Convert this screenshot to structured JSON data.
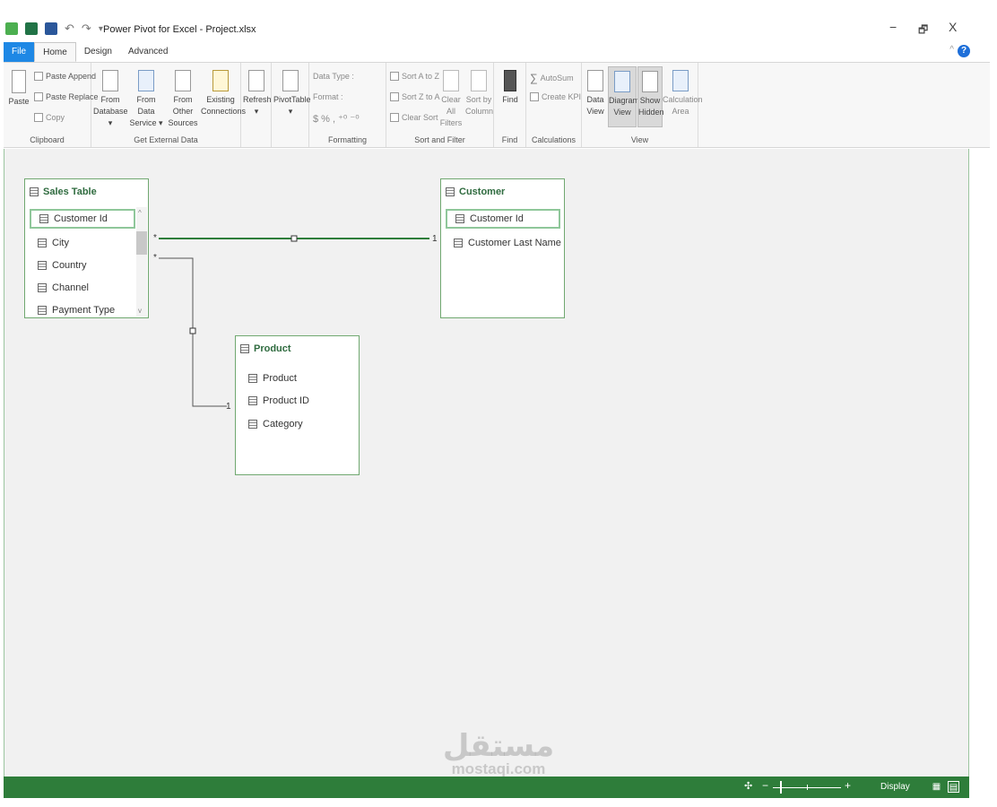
{
  "window": {
    "title": "Power Pivot for Excel - Project.xlsx",
    "minimize": "−",
    "restore": "🗗",
    "close": "X"
  },
  "tabs": [
    "File",
    "Home",
    "Design",
    "Advanced"
  ],
  "ribbon": {
    "clipboard": {
      "name": "Clipboard",
      "paste": "Paste",
      "paste_append": "Paste Append",
      "paste_replace": "Paste Replace",
      "copy": "Copy"
    },
    "external": {
      "name": "Get External Data",
      "from_database": [
        "From",
        "Database ▾"
      ],
      "from_data_service": [
        "From Data",
        "Service ▾"
      ],
      "from_other_sources": [
        "From Other",
        "Sources"
      ],
      "existing_connections": [
        "Existing",
        "Connections"
      ]
    },
    "refresh": {
      "label": "Refresh",
      "arrow": "▾"
    },
    "pivottable": {
      "label": "PivotTable",
      "arrow": "▾"
    },
    "formatting": {
      "name": "Formatting",
      "data_type": "Data Type :",
      "format": "Format :",
      "symbols": "$  %  ,  ⁺⁰  ⁻⁰"
    },
    "sort_filter": {
      "name": "Sort and Filter",
      "sort_az": "Sort A to Z",
      "sort_za": "Sort Z to A",
      "clear_sort": "Clear Sort",
      "clear_filters": [
        "Clear All",
        "Filters"
      ],
      "sort_by_column": [
        "Sort by",
        "Column"
      ]
    },
    "find": {
      "name": "Find",
      "label": "Find"
    },
    "calculations": {
      "name": "Calculations",
      "autosum": "AutoSum",
      "create_kpi": "Create KPI"
    },
    "view": {
      "name": "View",
      "data_view": [
        "Data",
        "View"
      ],
      "diagram_view": [
        "Diagram",
        "View"
      ],
      "show_hidden": [
        "Show",
        "Hidden"
      ],
      "calculation_area": [
        "Calculation",
        "Area"
      ]
    }
  },
  "diagram": {
    "tables": [
      {
        "name": "Sales Table",
        "fields": [
          "Customer Id",
          "City",
          "Country",
          "Channel",
          "Payment Type"
        ]
      },
      {
        "name": "Customer",
        "fields": [
          "Customer Id",
          "Customer Last Name"
        ]
      },
      {
        "name": "Product",
        "fields": [
          "Product",
          "Product ID",
          "Category"
        ]
      }
    ],
    "relationships": [
      {
        "from": "Sales Table",
        "to": "Customer",
        "from_card": "*",
        "to_card": "1"
      },
      {
        "from": "Sales Table",
        "to": "Product",
        "from_card": "*",
        "to_card": "1"
      }
    ],
    "scroll_up": "^",
    "scroll_down": "v"
  },
  "statusbar": {
    "zoom_minus": "−",
    "zoom_plus": "+",
    "display": "Display"
  },
  "watermark": {
    "arabic": "مستقل",
    "latin": "mostaqi.com"
  }
}
